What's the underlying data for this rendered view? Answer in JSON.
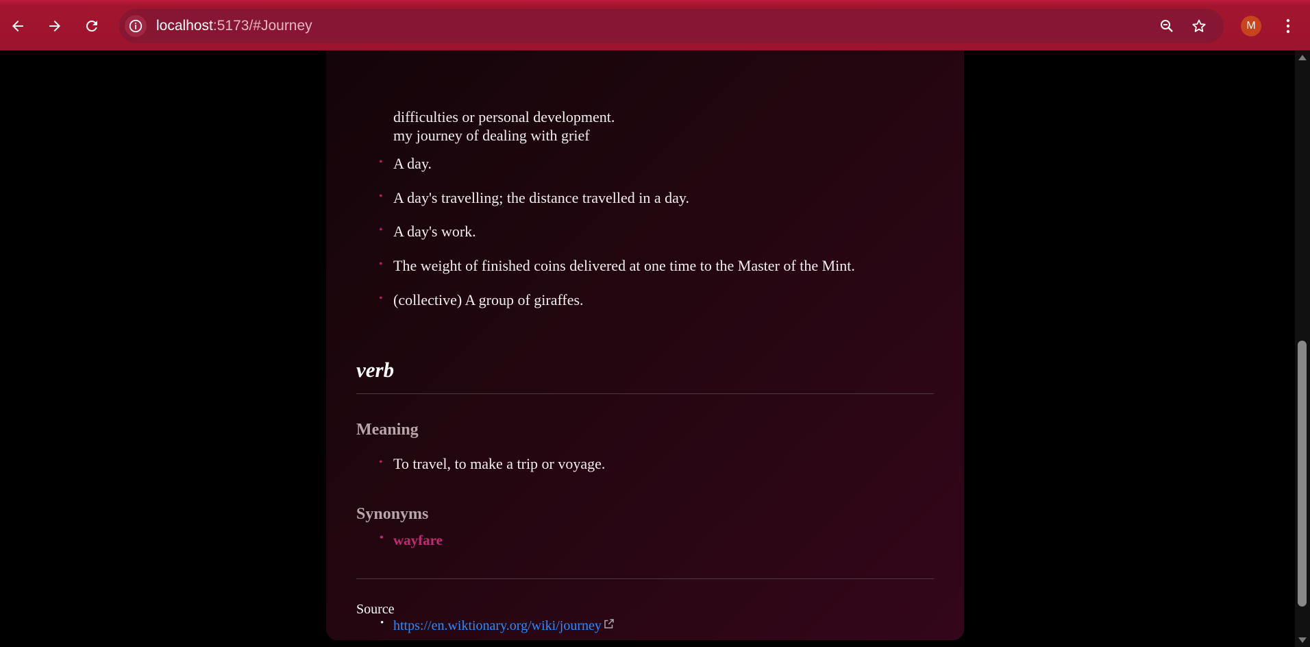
{
  "browser": {
    "url_host": "localhost",
    "url_rest": ":5173/#Journey",
    "avatar_letter": "M",
    "icons": {
      "back": "arrow-left-icon",
      "forward": "arrow-right-icon",
      "reload": "reload-icon",
      "site_info": "info-icon",
      "zoom": "zoom-icon",
      "bookmark": "star-icon",
      "menu": "kebab-menu-icon"
    },
    "colors": {
      "toolbar": "#a3152f",
      "omnibox": "#861631",
      "avatar": "#c8441c"
    }
  },
  "entry": {
    "partial_lines": [
      "difficulties or personal development.",
      "my journey of dealing with grief"
    ],
    "noun_definitions": [
      "A day.",
      "A day's travelling; the distance travelled in a day.",
      "A day's work.",
      "The weight of finished coins delivered at one time to the Master of the Mint.",
      "(collective) A group of giraffes."
    ],
    "verb": {
      "part_of_speech": "verb",
      "meaning_label": "Meaning",
      "definitions": [
        "To travel, to make a trip or voyage."
      ],
      "synonyms_label": "Synonyms",
      "synonyms": [
        "wayfare"
      ]
    },
    "source": {
      "label": "Source",
      "url": "https://en.wiktionary.org/wiki/journey"
    }
  },
  "colors": {
    "bullet": "#b0235f",
    "synonym": "#c22a73",
    "link": "#2b8cff",
    "subheading": "#b9a6ab",
    "card_start": "#130509",
    "card_end": "#34061a"
  }
}
